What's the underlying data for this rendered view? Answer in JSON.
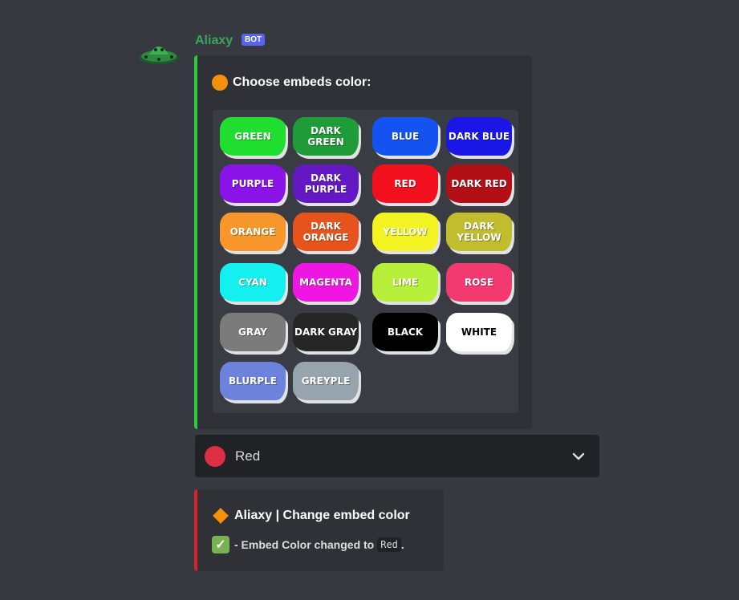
{
  "message": {
    "username": "Aliaxy",
    "bot_tag": "BOT"
  },
  "embed1": {
    "title": "Choose embeds color:",
    "accent": "#2ecc40",
    "title_icon": "orange-circle-icon"
  },
  "swatches": [
    {
      "label": "GREEN",
      "color": "#1fde2f"
    },
    {
      "label": "DARK GREEN",
      "color": "#1f9b38"
    },
    {
      "label": "BLUE",
      "color": "#1553f0"
    },
    {
      "label": "DARK BLUE",
      "color": "#1a16e6"
    },
    {
      "label": "PURPLE",
      "color": "#8a14e8"
    },
    {
      "label": "DARK PURPLE",
      "color": "#6318c4"
    },
    {
      "label": "RED",
      "color": "#f2101f"
    },
    {
      "label": "DARK RED",
      "color": "#b30f17"
    },
    {
      "label": "ORANGE",
      "color": "#f7962a"
    },
    {
      "label": "DARK ORANGE",
      "color": "#e6531b"
    },
    {
      "label": "YELLOW",
      "color": "#f3f322"
    },
    {
      "label": "DARK YELLOW",
      "color": "#c2bd2f"
    },
    {
      "label": "CYAN",
      "color": "#14f0f0"
    },
    {
      "label": "MAGENTA",
      "color": "#ef16e3"
    },
    {
      "label": "LIME",
      "color": "#b6f03a"
    },
    {
      "label": "ROSE",
      "color": "#f23a70"
    },
    {
      "label": "GRAY",
      "color": "#7b7b7b"
    },
    {
      "label": "DARK GRAY",
      "color": "#262626"
    },
    {
      "label": "BLACK",
      "color": "#000000"
    },
    {
      "label": "WHITE",
      "color": "#ffffff"
    },
    {
      "label": "BLURPLE",
      "color": "#6d82da"
    },
    {
      "label": "GREYPLE",
      "color": "#98a4ad"
    }
  ],
  "dropdown": {
    "selected": "Red",
    "dot_color": "#dd2e44",
    "icon": "chevron-down-icon"
  },
  "embed2": {
    "title": "Aliaxy | Change embed color",
    "accent": "#dd1f2b",
    "title_icon": "orange-diamond-icon",
    "desc_prefix": "- Embed Color changed to",
    "desc_code": "Red",
    "desc_suffix": ".",
    "desc_icon": "white-check-mark-icon"
  }
}
